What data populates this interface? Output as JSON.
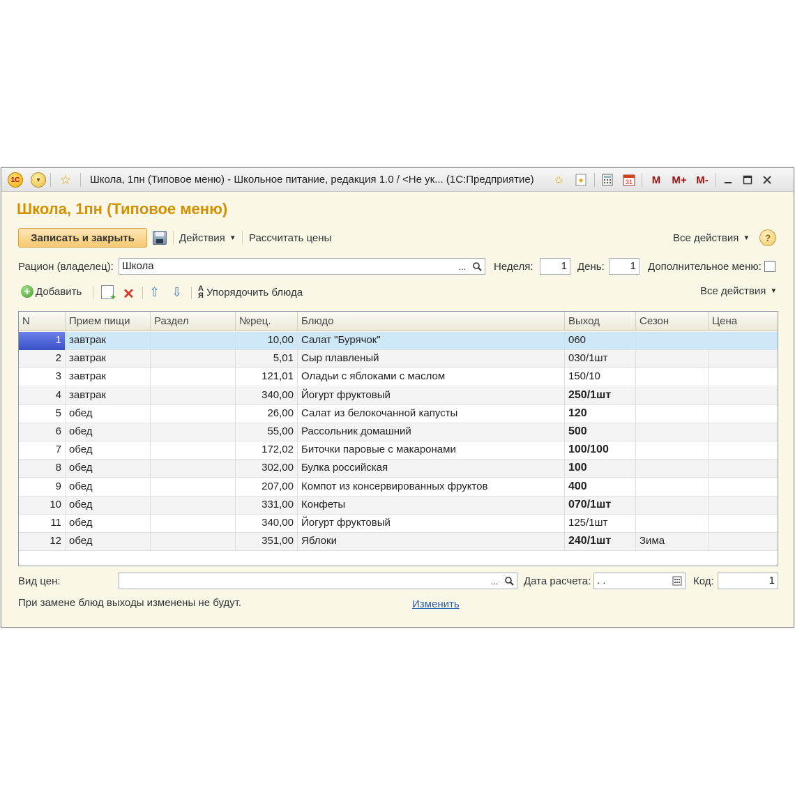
{
  "titlebar": {
    "logo": "1С",
    "title": "Школа, 1пн (Типовое меню) - Школьное питание, редакция 1.0 / <Не ук...   (1С:Предприятие)",
    "calc_day": "31",
    "m": "M",
    "mplus": "M+",
    "mminus": "M-",
    "icons": [
      "logo-1c-icon",
      "menu-dropdown-icon",
      "favorites-star-icon",
      "star-add-icon",
      "bookmark-icon",
      "calculator-icon",
      "calendar-icon",
      "minimize-icon",
      "maximize-icon",
      "close-icon"
    ]
  },
  "form": {
    "title": "Школа, 1пн (Типовое меню)"
  },
  "commandbar": {
    "save_close": "Записать и закрыть",
    "actions": "Действия",
    "calc_prices": "Рассчитать цены",
    "all_actions": "Все действия",
    "help": "?"
  },
  "fields": {
    "ration_label": "Рацион (владелец):",
    "ration_value": "Школа",
    "week_label": "Неделя:",
    "week_value": "1",
    "day_label": "День:",
    "day_value": "1",
    "extra_menu_label": "Дополнительное меню:",
    "extra_menu_checked": false,
    "dots": "...",
    "search_glyph": "🔍"
  },
  "table_toolbar": {
    "add": "Добавить",
    "sort": "Упорядочить блюда",
    "all_actions": "Все действия"
  },
  "table": {
    "columns": [
      "N",
      "Прием пищи",
      "Раздел",
      "№рец.",
      "Блюдо",
      "Выход",
      "Сезон",
      "Цена"
    ],
    "rows": [
      {
        "n": "1",
        "meal": "завтрак",
        "section": "",
        "rec": "10,00",
        "dish": "Салат \"Бурячок\"",
        "out": "060",
        "bold": false,
        "season": "",
        "price": ""
      },
      {
        "n": "2",
        "meal": "завтрак",
        "section": "",
        "rec": "5,01",
        "dish": "Сыр плавленый",
        "out": "030/1шт",
        "bold": false,
        "season": "",
        "price": ""
      },
      {
        "n": "3",
        "meal": "завтрак",
        "section": "",
        "rec": "121,01",
        "dish": "Оладьи с яблоками с маслом",
        "out": "150/10",
        "bold": false,
        "season": "",
        "price": ""
      },
      {
        "n": "4",
        "meal": "завтрак",
        "section": "",
        "rec": "340,00",
        "dish": "Йогурт фруктовый",
        "out": "250/1шт",
        "bold": true,
        "season": "",
        "price": ""
      },
      {
        "n": "5",
        "meal": "обед",
        "section": "",
        "rec": "26,00",
        "dish": "Салат из белокочанной капусты",
        "out": "120",
        "bold": true,
        "season": "",
        "price": ""
      },
      {
        "n": "6",
        "meal": "обед",
        "section": "",
        "rec": "55,00",
        "dish": "Рассольник домашний",
        "out": "500",
        "bold": true,
        "season": "",
        "price": ""
      },
      {
        "n": "7",
        "meal": "обед",
        "section": "",
        "rec": "172,02",
        "dish": "Биточки паровые с макаронами",
        "out": "100/100",
        "bold": true,
        "season": "",
        "price": ""
      },
      {
        "n": "8",
        "meal": "обед",
        "section": "",
        "rec": "302,00",
        "dish": "Булка российская",
        "out": "100",
        "bold": true,
        "season": "",
        "price": ""
      },
      {
        "n": "9",
        "meal": "обед",
        "section": "",
        "rec": "207,00",
        "dish": "Компот из консервированных фруктов",
        "out": "400",
        "bold": true,
        "season": "",
        "price": ""
      },
      {
        "n": "10",
        "meal": "обед",
        "section": "",
        "rec": "331,00",
        "dish": "Конфеты",
        "out": "070/1шт",
        "bold": true,
        "season": "",
        "price": ""
      },
      {
        "n": "11",
        "meal": "обед",
        "section": "",
        "rec": "340,00",
        "dish": "Йогурт фруктовый",
        "out": "125/1шт",
        "bold": false,
        "season": "",
        "price": ""
      },
      {
        "n": "12",
        "meal": "обед",
        "section": "",
        "rec": "351,00",
        "dish": "Яблоки",
        "out": "240/1шт",
        "bold": true,
        "season": "Зима",
        "price": ""
      }
    ],
    "selected_row": 0
  },
  "footer": {
    "price_type_label": "Вид цен:",
    "price_type_value": "",
    "calc_date_label": "Дата расчета:",
    "calc_date_value": " .  .",
    "code_label": "Код:",
    "code_value": "1",
    "note": "При замене блюд выходы изменены не будут.",
    "change_link": "Изменить"
  },
  "colors": {
    "form_title": "#d49000",
    "window_bg": "#fbf8e8",
    "selected_row": "#cfe8f8",
    "link": "#2a5bb0"
  }
}
